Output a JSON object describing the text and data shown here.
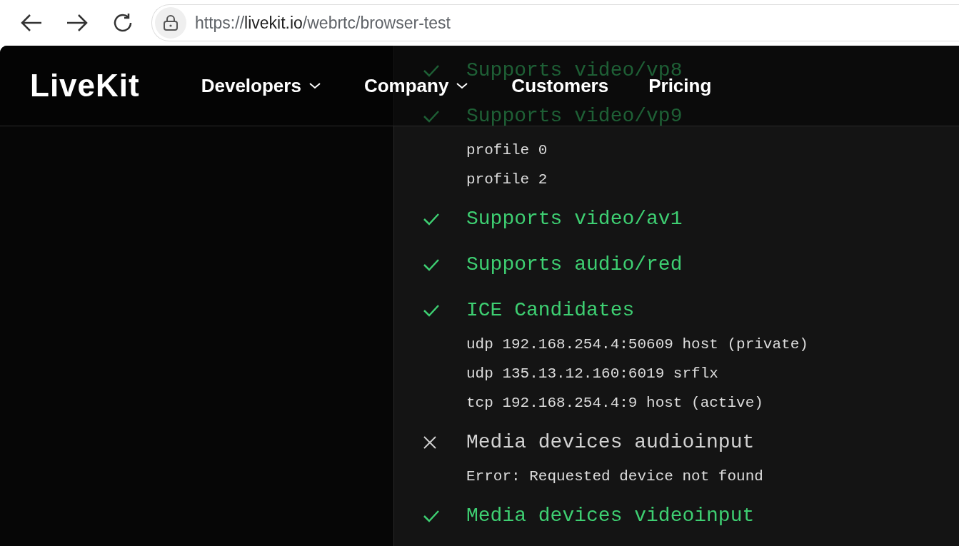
{
  "browser": {
    "url_host": "livekit.io",
    "url_scheme": "https://",
    "url_path": "/webrtc/browser-test"
  },
  "site_header": {
    "logo": "LiveKit",
    "nav": [
      {
        "label": "Developers",
        "dropdown": true
      },
      {
        "label": "Company",
        "dropdown": true
      },
      {
        "label": "Customers",
        "dropdown": false
      },
      {
        "label": "Pricing",
        "dropdown": false
      }
    ]
  },
  "checks": [
    {
      "label": "Supports video/vp8",
      "passed": true
    },
    {
      "label": "Supports video/vp9",
      "passed": true,
      "details": [
        "profile 0",
        "profile 2"
      ]
    },
    {
      "label": "Supports video/av1",
      "passed": true
    },
    {
      "label": "Supports audio/red",
      "passed": true
    },
    {
      "label": "ICE Candidates",
      "passed": true,
      "details": [
        "udp 192.168.254.4:50609 host (private)",
        "udp 135.13.12.160:6019 srflx",
        "tcp 192.168.254.4:9 host (active)"
      ]
    },
    {
      "label": "Media devices audioinput",
      "passed": false,
      "details": [
        "Error: Requested device not found"
      ]
    },
    {
      "label": "Media devices videoinput",
      "passed": true
    }
  ]
}
